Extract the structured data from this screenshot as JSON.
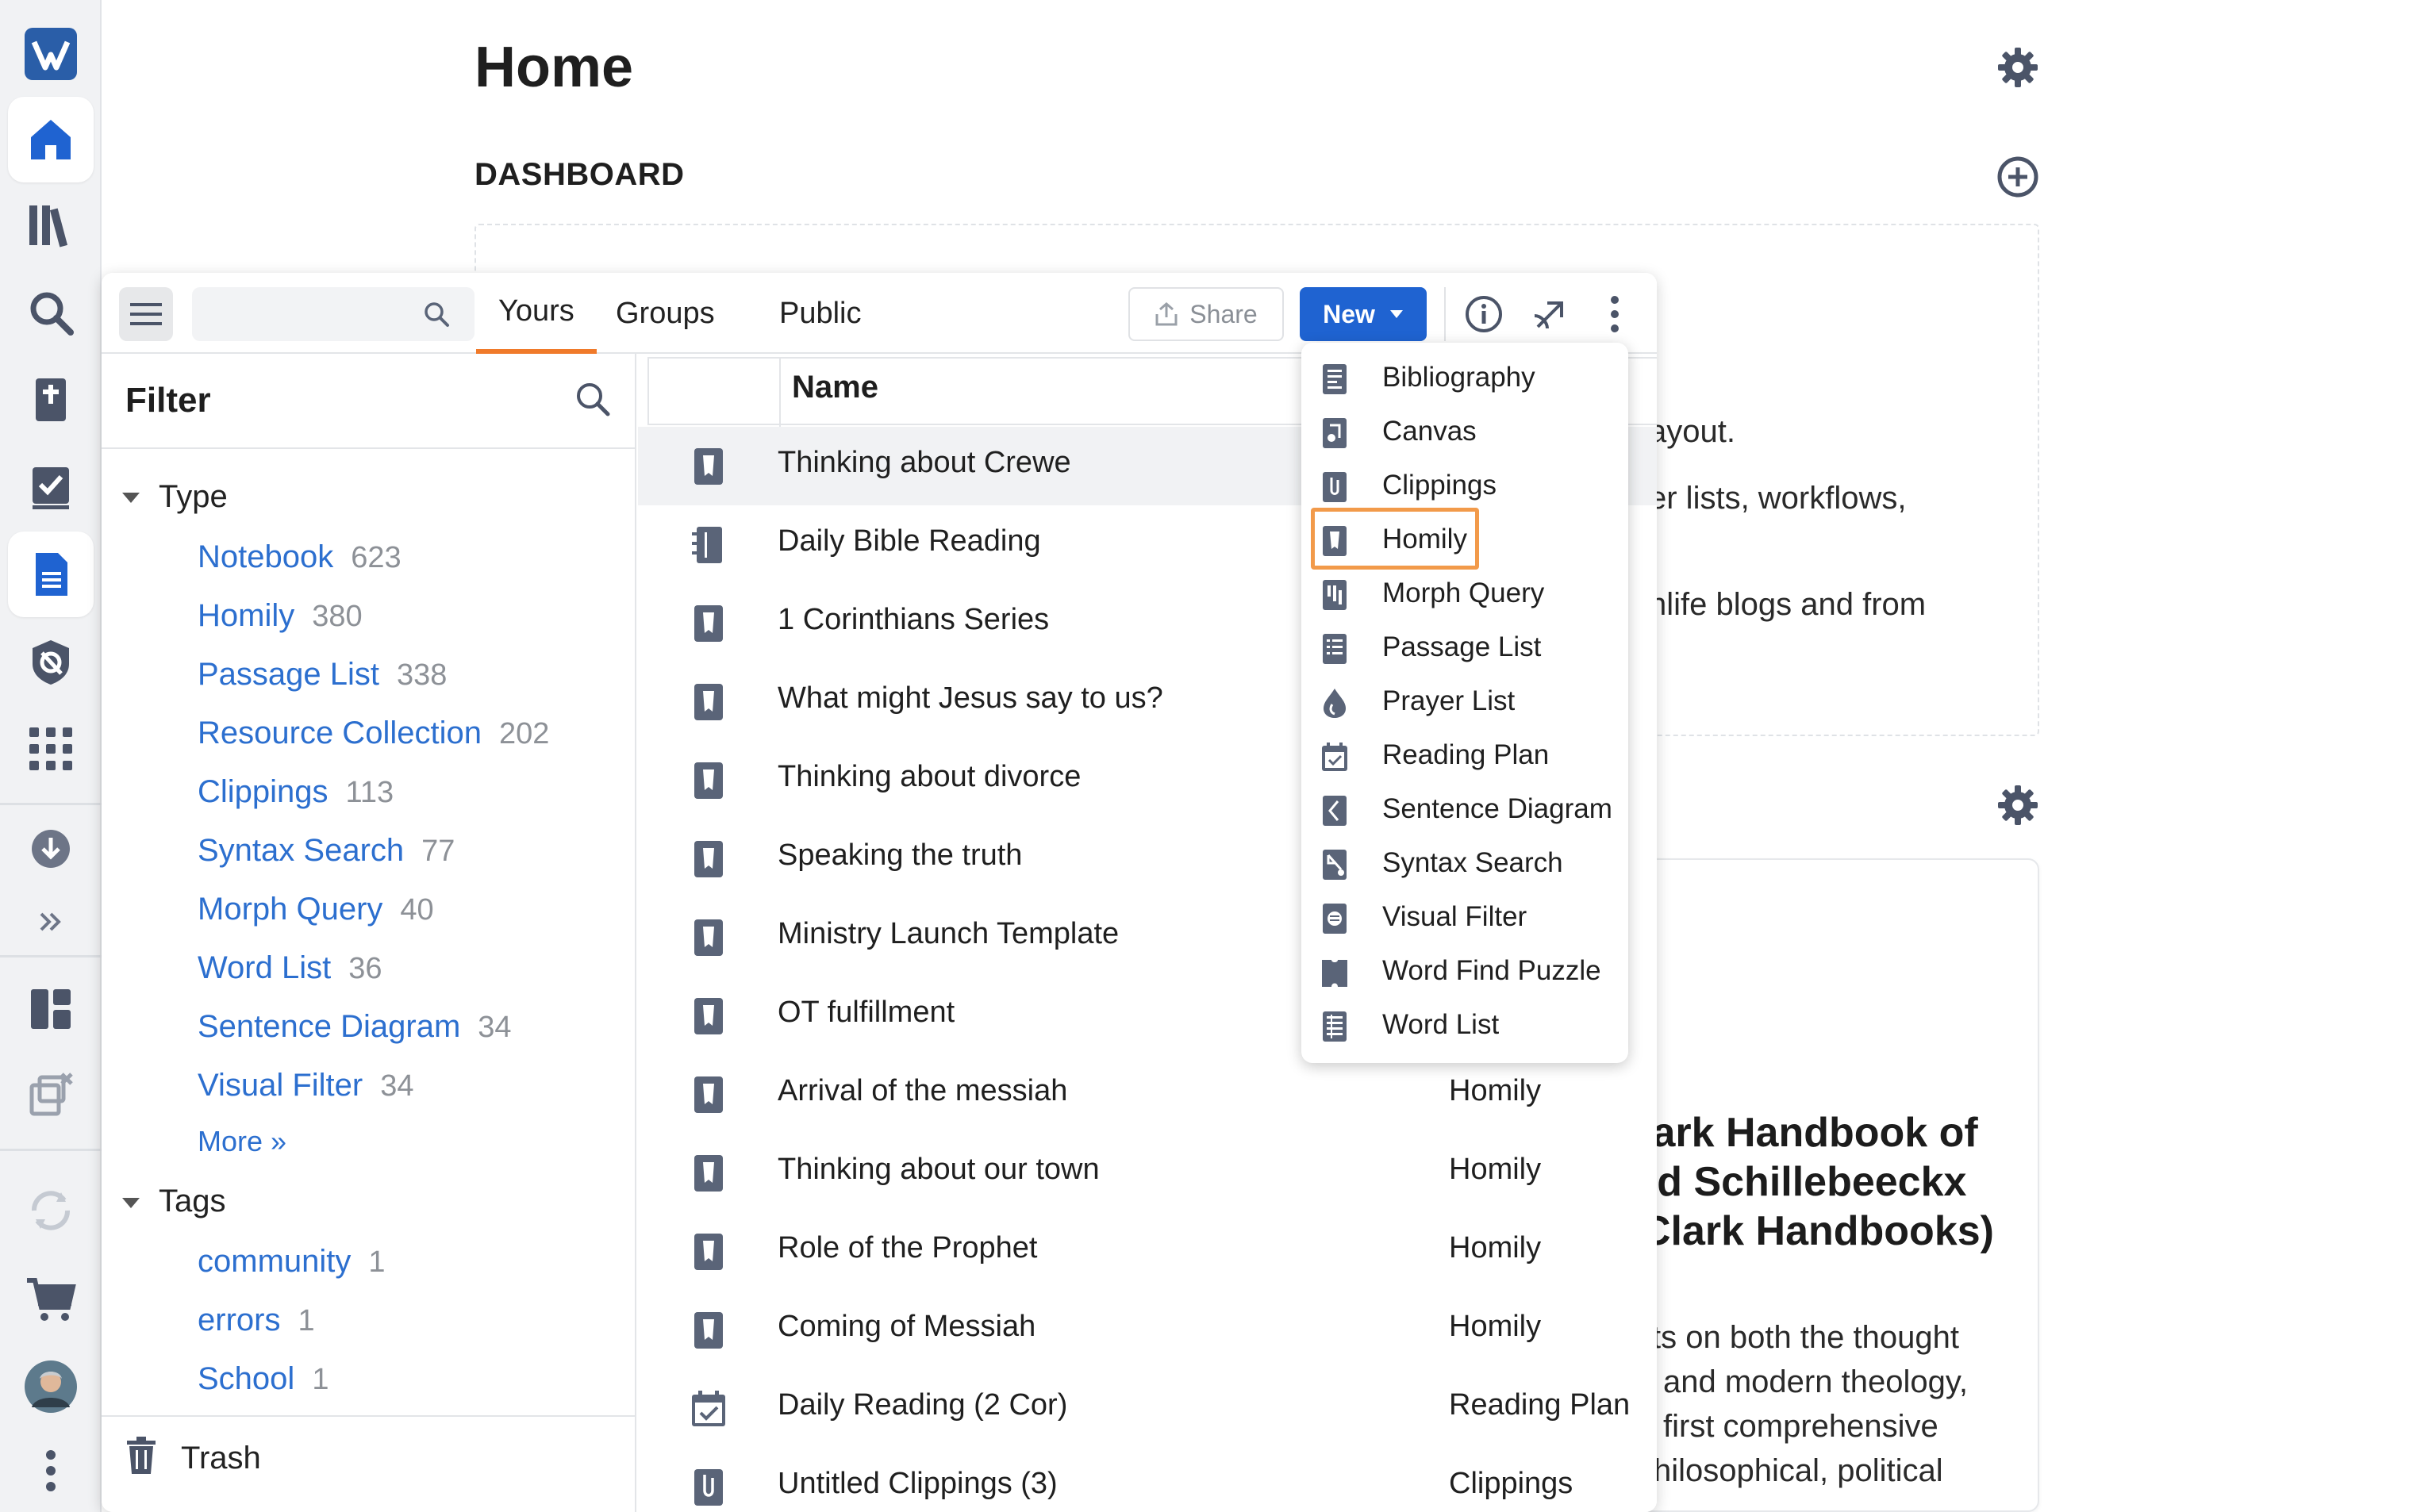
{
  "home": {
    "title": "Home",
    "dashboard_label": "DASHBOARD",
    "bg_lines": [
      "ayout.",
      "er lists, workflows,",
      "hlife blogs and from"
    ],
    "book_title_lines": [
      "lark Handbook of",
      "rd Schillebeeckx",
      "Clark Handbooks)"
    ],
    "book_desc_lines": [
      "ts on both the thought",
      "and modern theology,",
      "first comprehensive",
      "hilosophical, political"
    ]
  },
  "header": {
    "search_placeholder": "",
    "tabs": [
      {
        "label": "Yours",
        "active": true
      },
      {
        "label": "Groups",
        "active": false
      },
      {
        "label": "Public",
        "active": false
      }
    ],
    "share_label": "Share",
    "new_label": "New"
  },
  "filter": {
    "title": "Filter",
    "type_label": "Type",
    "types": [
      {
        "label": "Notebook",
        "count": "623"
      },
      {
        "label": "Homily",
        "count": "380"
      },
      {
        "label": "Passage List",
        "count": "338"
      },
      {
        "label": "Resource Collection",
        "count": "202"
      },
      {
        "label": "Clippings",
        "count": "113"
      },
      {
        "label": "Syntax Search",
        "count": "77"
      },
      {
        "label": "Morph Query",
        "count": "40"
      },
      {
        "label": "Word List",
        "count": "36"
      },
      {
        "label": "Sentence Diagram",
        "count": "34"
      },
      {
        "label": "Visual Filter",
        "count": "34"
      }
    ],
    "more_label": "More »",
    "tags_label": "Tags",
    "tags": [
      {
        "label": "community",
        "count": "1"
      },
      {
        "label": "errors",
        "count": "1"
      },
      {
        "label": "School",
        "count": "1"
      }
    ],
    "trash_label": "Trash"
  },
  "list": {
    "name_header": "Name",
    "rows": [
      {
        "name": "Thinking about Crewe",
        "type": "",
        "icon": "homily-icon"
      },
      {
        "name": "Daily Bible Reading",
        "type": "",
        "icon": "notebook-icon"
      },
      {
        "name": "1 Corinthians Series",
        "type": "",
        "icon": "homily-icon"
      },
      {
        "name": "What might Jesus say to us?",
        "type": "",
        "icon": "homily-icon"
      },
      {
        "name": "Thinking about divorce",
        "type": "",
        "icon": "homily-icon"
      },
      {
        "name": "Speaking the truth",
        "type": "",
        "icon": "homily-icon"
      },
      {
        "name": "Ministry Launch Template",
        "type": "",
        "icon": "homily-icon"
      },
      {
        "name": "OT fulfillment",
        "type": "",
        "icon": "homily-icon"
      },
      {
        "name": "Arrival of the messiah",
        "type": "Homily",
        "icon": "homily-icon"
      },
      {
        "name": "Thinking about our town",
        "type": "Homily",
        "icon": "homily-icon"
      },
      {
        "name": "Role of the Prophet",
        "type": "Homily",
        "icon": "homily-icon"
      },
      {
        "name": "Coming of Messiah",
        "type": "Homily",
        "icon": "homily-icon"
      },
      {
        "name": "Daily Reading (2 Cor)",
        "type": "Reading Plan",
        "icon": "calendar-check-icon"
      },
      {
        "name": "Untitled Clippings (3)",
        "type": "Clippings",
        "icon": "clippings-icon"
      }
    ]
  },
  "new_menu": {
    "items": [
      {
        "label": "Bibliography",
        "icon": "bibliography-icon"
      },
      {
        "label": "Canvas",
        "icon": "canvas-icon"
      },
      {
        "label": "Clippings",
        "icon": "clippings-icon"
      },
      {
        "label": "Homily",
        "icon": "homily-icon"
      },
      {
        "label": "Morph Query",
        "icon": "morph-query-icon"
      },
      {
        "label": "Passage List",
        "icon": "passage-list-icon"
      },
      {
        "label": "Prayer List",
        "icon": "prayer-list-icon"
      },
      {
        "label": "Reading Plan",
        "icon": "reading-plan-icon"
      },
      {
        "label": "Sentence Diagram",
        "icon": "sentence-diagram-icon"
      },
      {
        "label": "Syntax Search",
        "icon": "syntax-search-icon"
      },
      {
        "label": "Visual Filter",
        "icon": "visual-filter-icon"
      },
      {
        "label": "Word Find Puzzle",
        "icon": "word-find-puzzle-icon"
      },
      {
        "label": "Word List",
        "icon": "word-list-icon"
      }
    ],
    "highlighted": "Homily"
  },
  "colors": {
    "accent": "#1f63d1",
    "link": "#2c6fcf",
    "tab_underline": "#f07a2a",
    "highlight": "#f29a4a",
    "icon": "#5a6478"
  }
}
